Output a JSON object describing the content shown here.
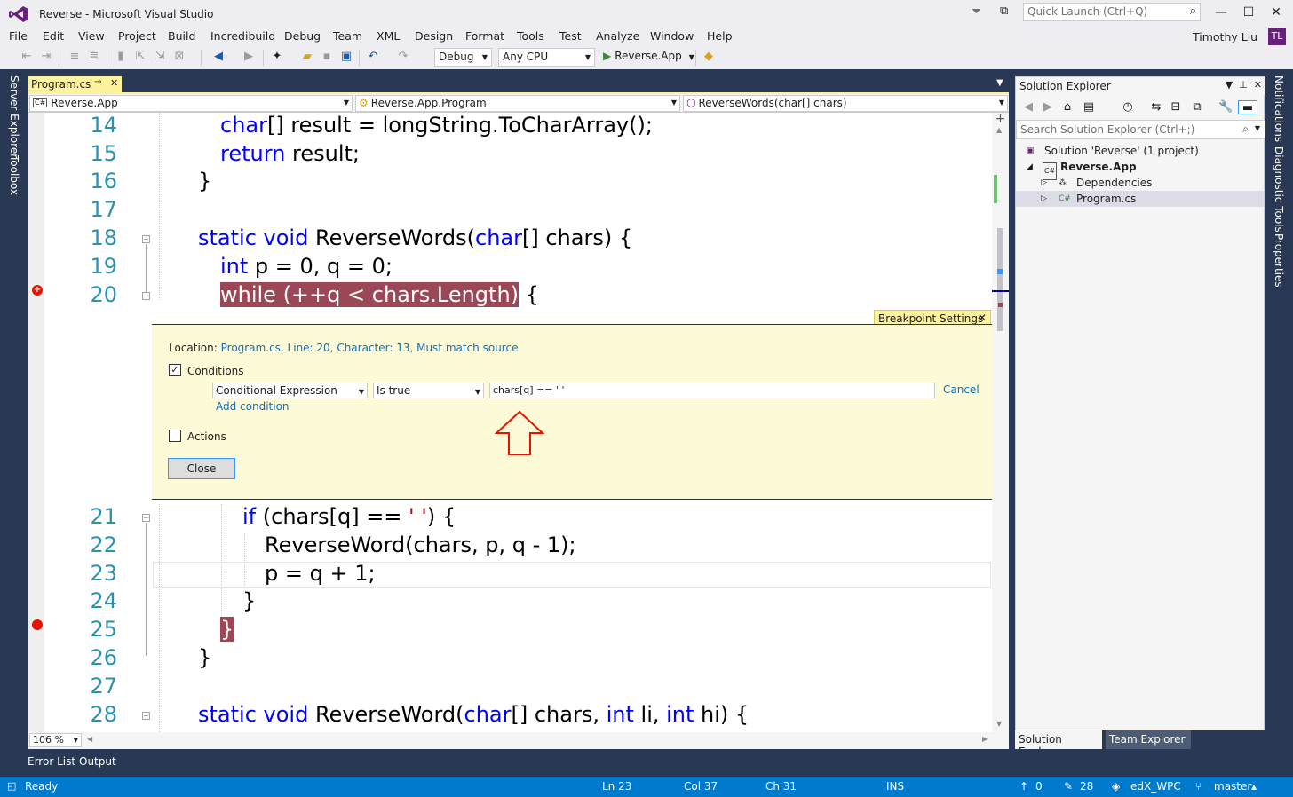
{
  "window": {
    "title": "Reverse - Microsoft Visual Studio",
    "quick_launch_placeholder": "Quick Launch (Ctrl+Q)",
    "user_name": "Timothy Liu",
    "avatar_initials": "TL"
  },
  "menu": [
    "File",
    "Edit",
    "View",
    "Project",
    "Build",
    "Incredibuild",
    "Debug",
    "Team",
    "XML",
    "Design",
    "Format",
    "Tools",
    "Test",
    "Analyze",
    "Window",
    "Help"
  ],
  "toolbar": {
    "config": "Debug",
    "platform": "Any CPU",
    "start_target": "Reverse.App"
  },
  "left_tabs": [
    "Server Explorer",
    "Toolbox"
  ],
  "right_tabs": [
    "Notifications",
    "Diagnostic Tools",
    "Properties"
  ],
  "document_tab": {
    "name": "Program.cs"
  },
  "navbar": {
    "project": "Reverse.App",
    "type": "Reverse.App.Program",
    "member": "ReverseWords(char[] chars)"
  },
  "code_lines": [
    {
      "num": "14"
    },
    {
      "num": "15"
    },
    {
      "num": "16"
    },
    {
      "num": "17"
    },
    {
      "num": "18"
    },
    {
      "num": "19"
    },
    {
      "num": "20"
    },
    {
      "num": "21"
    },
    {
      "num": "22"
    },
    {
      "num": "23"
    },
    {
      "num": "24"
    },
    {
      "num": "25"
    },
    {
      "num": "26"
    },
    {
      "num": "27"
    },
    {
      "num": "28"
    }
  ],
  "code": {
    "l14_kw": "char",
    "l14_rest": "[] result = longString.ToCharArray();",
    "l15_kw": "return",
    "l15_rest": " result;",
    "l16": "}",
    "l18_kw1": "static",
    "l18_kw2": "void",
    "l18_name": " ReverseWords(",
    "l18_kw3": "char",
    "l18_rest": "[] chars) {",
    "l19_kw": "int",
    "l19_rest": " p = 0, q = 0;",
    "l20_hl": "while (++q < chars.Length)",
    "l20_rest": " {",
    "l21_kw": "if",
    "l21_a": " (chars[q] == ",
    "l21_str": "' '",
    "l21_b": ") {",
    "l22": "ReverseWord(chars, p, q - 1);",
    "l23": "p = q + 1;",
    "l24": "}",
    "l25": "}",
    "l26": "}",
    "l28_kw1": "static",
    "l28_kw2": "void",
    "l28_name": " ReverseWord(",
    "l28_kw3": "char",
    "l28_a": "[] chars, ",
    "l28_kw4": "int",
    "l28_b": " li, ",
    "l28_kw5": "int",
    "l28_c": " hi) {"
  },
  "breakpoint_settings": {
    "tab_title": "Breakpoint Settings",
    "location_label": "Location: ",
    "location_value": "Program.cs, Line: 20, Character: 13, Must match source",
    "conditions_label": "Conditions",
    "conditions_checked": true,
    "condition_type": "Conditional Expression",
    "condition_op": "Is true",
    "condition_expr": "chars[q] == ' '",
    "cancel_label": "Cancel",
    "add_condition_label": "Add condition",
    "actions_label": "Actions",
    "actions_checked": false,
    "close_label": "Close"
  },
  "zoom": "106 %",
  "solution_explorer": {
    "title": "Solution Explorer",
    "search_placeholder": "Search Solution Explorer (Ctrl+;)",
    "solution": "Solution 'Reverse' (1 project)",
    "project": "Reverse.App",
    "dependencies": "Dependencies",
    "file": "Program.cs",
    "tab_active": "Solution Explorer",
    "tab_other": "Team Explorer"
  },
  "bottom_tabs": [
    "Error List",
    "Output"
  ],
  "status": {
    "ready": "Ready",
    "ln": "Ln 23",
    "col": "Col 37",
    "ch": "Ch 31",
    "ins": "INS",
    "up_count": "0",
    "pencil_count": "28",
    "repo": "edX_WPC",
    "branch": "master"
  },
  "colors": {
    "accent": "#007acc",
    "chrome_dark": "#293955",
    "keyword": "#0000ff",
    "line_number": "#2b91af",
    "breakpoint_highlight": "#9c4756",
    "peek_background": "#fdfbd7"
  }
}
